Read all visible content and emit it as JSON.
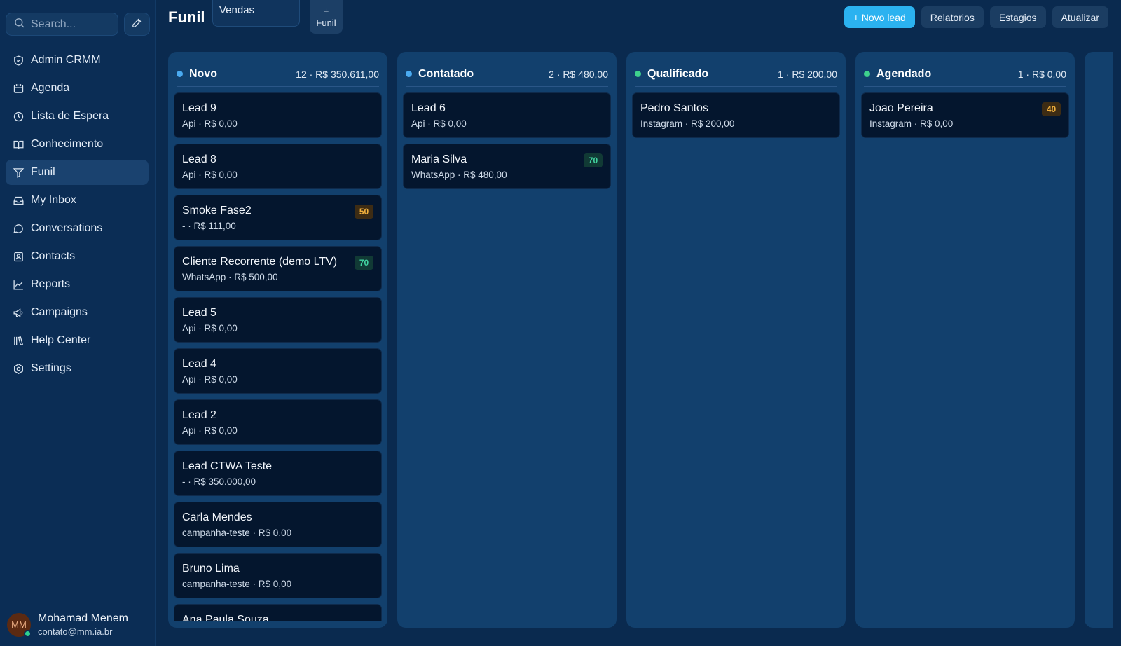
{
  "sidebar": {
    "search_placeholder": "Search...",
    "items": [
      {
        "label": "Admin CRMM",
        "icon": "shield-icon",
        "active": false
      },
      {
        "label": "Agenda",
        "icon": "calendar-icon",
        "active": false
      },
      {
        "label": "Lista de Espera",
        "icon": "clock-icon",
        "active": false
      },
      {
        "label": "Conhecimento",
        "icon": "book-icon",
        "active": false
      },
      {
        "label": "Funil",
        "icon": "filter-icon",
        "active": true
      },
      {
        "label": "My Inbox",
        "icon": "inbox-icon",
        "active": false
      },
      {
        "label": "Conversations",
        "icon": "chat-bubble-icon",
        "active": false
      },
      {
        "label": "Contacts",
        "icon": "contact-card-icon",
        "active": false
      },
      {
        "label": "Reports",
        "icon": "line-chart-icon",
        "active": false
      },
      {
        "label": "Campaigns",
        "icon": "megaphone-icon",
        "active": false
      },
      {
        "label": "Help Center",
        "icon": "library-icon",
        "active": false
      },
      {
        "label": "Settings",
        "icon": "gear-icon",
        "active": false
      }
    ],
    "user": {
      "initials": "MM",
      "name": "Mohamad Menem",
      "email": "contato@mm.ia.br",
      "status_color": "#2fd08f"
    }
  },
  "header": {
    "title": "Funil",
    "pipeline_select": "Vendas",
    "new_funnel_label": "+\nFunil",
    "buttons": {
      "new_lead": "+ Novo lead",
      "reports": "Relatorios",
      "stages": "Estagios",
      "refresh": "Atualizar"
    }
  },
  "colors": {
    "accent": "#2bb2f0",
    "blue_dot": "#4aaaf0",
    "green_dot": "#3ed18d"
  },
  "columns": [
    {
      "title": "Novo",
      "stats": "12 · R$ 350.611,00",
      "dot": "#4aaaf0",
      "cards": [
        {
          "title": "Lead 9",
          "sub": "Api · R$ 0,00"
        },
        {
          "title": "Lead 8",
          "sub": "Api · R$ 0,00"
        },
        {
          "title": "Smoke Fase2",
          "sub": "- · R$ 111,00",
          "badge": "50",
          "badge_tone": "amber"
        },
        {
          "title": "Cliente Recorrente (demo LTV)",
          "sub": "WhatsApp · R$ 500,00",
          "badge": "70",
          "badge_tone": "green"
        },
        {
          "title": "Lead 5",
          "sub": "Api · R$ 0,00"
        },
        {
          "title": "Lead 4",
          "sub": "Api · R$ 0,00"
        },
        {
          "title": "Lead 2",
          "sub": "Api · R$ 0,00"
        },
        {
          "title": "Lead CTWA Teste",
          "sub": "- · R$ 350.000,00"
        },
        {
          "title": "Carla Mendes",
          "sub": "campanha-teste · R$ 0,00"
        },
        {
          "title": "Bruno Lima",
          "sub": "campanha-teste · R$ 0,00"
        },
        {
          "title": "Ana Paula Souza",
          "sub": ""
        }
      ]
    },
    {
      "title": "Contatado",
      "stats": "2 · R$ 480,00",
      "dot": "#4aaaf0",
      "cards": [
        {
          "title": "Lead 6",
          "sub": "Api · R$ 0,00"
        },
        {
          "title": "Maria Silva",
          "sub": "WhatsApp · R$ 480,00",
          "badge": "70",
          "badge_tone": "green"
        }
      ]
    },
    {
      "title": "Qualificado",
      "stats": "1 · R$ 200,00",
      "dot": "#3ed18d",
      "cards": [
        {
          "title": "Pedro Santos",
          "sub": "Instagram · R$ 200,00"
        }
      ]
    },
    {
      "title": "Agendado",
      "stats": "1 · R$ 0,00",
      "dot": "#3ed18d",
      "cards": [
        {
          "title": "Joao Pereira",
          "sub": "Instagram · R$ 0,00",
          "badge": "40",
          "badge_tone": "amber"
        }
      ]
    }
  ]
}
